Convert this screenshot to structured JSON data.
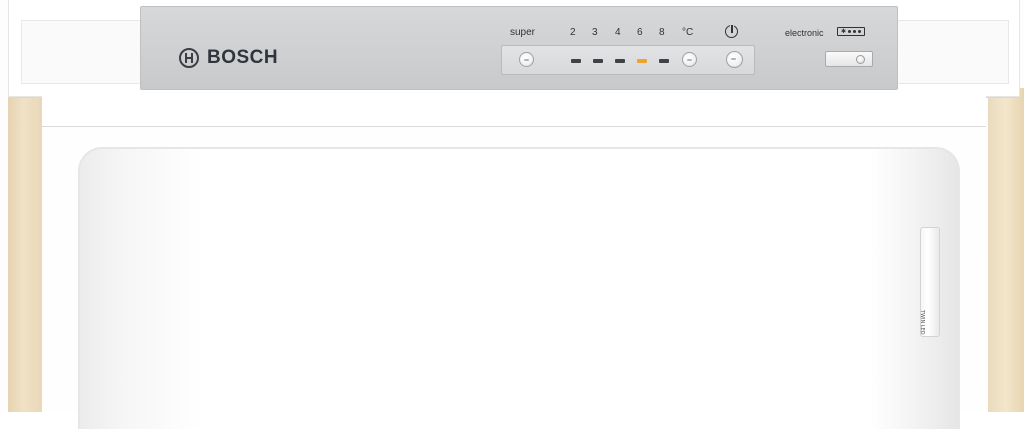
{
  "brand": {
    "name": "BOSCH"
  },
  "control_panel": {
    "super_label": "super",
    "temperature_settings": [
      "2",
      "3",
      "4",
      "6",
      "8"
    ],
    "unit_label": "°C",
    "electronic_label": "electronic",
    "active_led_color": "#f0a22a",
    "inactive_led_color": "#3f4348",
    "selected_setting": "6"
  },
  "handle": {
    "label": "TWIN LED"
  },
  "colors": {
    "side_panel": "#f0e2c6",
    "panel": "#d0d1d3"
  }
}
